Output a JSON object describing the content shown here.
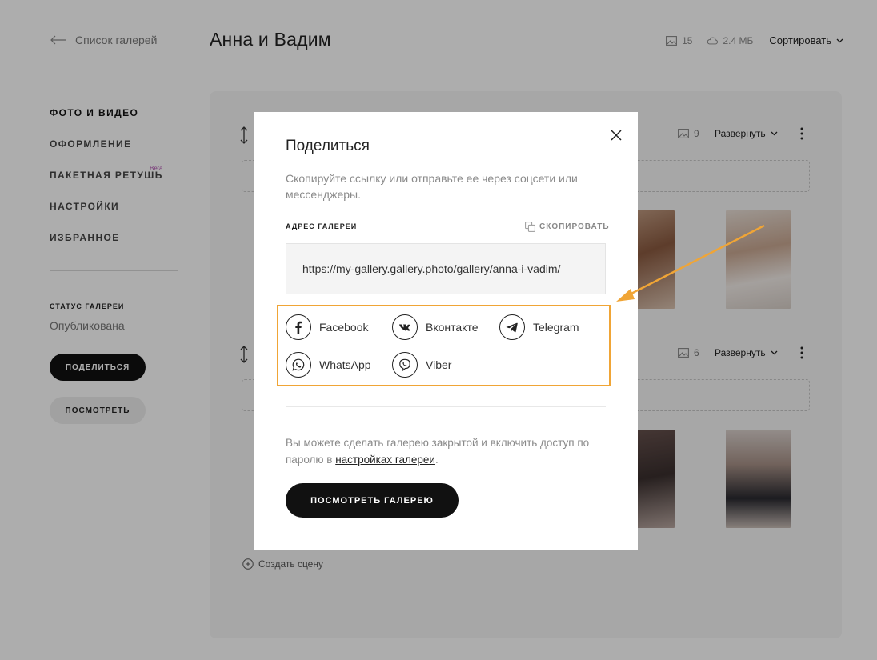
{
  "header": {
    "back_label": "Список галерей",
    "title": "Анна и Вадим",
    "photo_count": "15",
    "storage": "2.4 МБ",
    "sort_label": "Сортировать"
  },
  "sidebar": {
    "items": [
      {
        "label": "ФОТО И ВИДЕО"
      },
      {
        "label": "ОФОРМЛЕНИЕ"
      },
      {
        "label": "ПАКЕТНАЯ РЕТУШЬ",
        "badge": "Beta"
      },
      {
        "label": "НАСТРОЙКИ"
      },
      {
        "label": "ИЗБРАННОЕ"
      }
    ],
    "status_label": "СТАТУС ГАЛЕРЕИ",
    "status_value": "Опубликована",
    "share_button": "ПОДЕЛИТЬСЯ",
    "view_button": "ПОСМОТРЕТЬ"
  },
  "scenes": [
    {
      "count": "9",
      "expand_label": "Развернуть"
    },
    {
      "count": "6",
      "expand_label": "Развернуть"
    }
  ],
  "create_scene_label": "Создать сцену",
  "modal": {
    "title": "Поделиться",
    "description": "Скопируйте ссылку или отправьте ее через соцсети или мессенджеры.",
    "address_label": "АДРЕС ГАЛЕРЕИ",
    "copy_label": "СКОПИРОВАТЬ",
    "url": "https://my-gallery.gallery.photo/gallery/anna-i-vadim/",
    "socials": [
      {
        "name": "Facebook",
        "icon": "facebook-icon"
      },
      {
        "name": "Вконтакте",
        "icon": "vk-icon"
      },
      {
        "name": "Telegram",
        "icon": "telegram-icon"
      },
      {
        "name": "WhatsApp",
        "icon": "whatsapp-icon"
      },
      {
        "name": "Viber",
        "icon": "viber-icon"
      }
    ],
    "note_prefix": "Вы можете сделать галерею закрытой и включить доступ по паролю в ",
    "note_link": "настройках галереи",
    "note_suffix": ".",
    "view_gallery_button": "ПОСМОТРЕТЬ ГАЛЕРЕЮ"
  },
  "colors": {
    "highlight": "#f0a536",
    "beta": "#b04fb0",
    "primary_button": "#111111",
    "overlay": "rgba(0,0,0,0.32)"
  }
}
